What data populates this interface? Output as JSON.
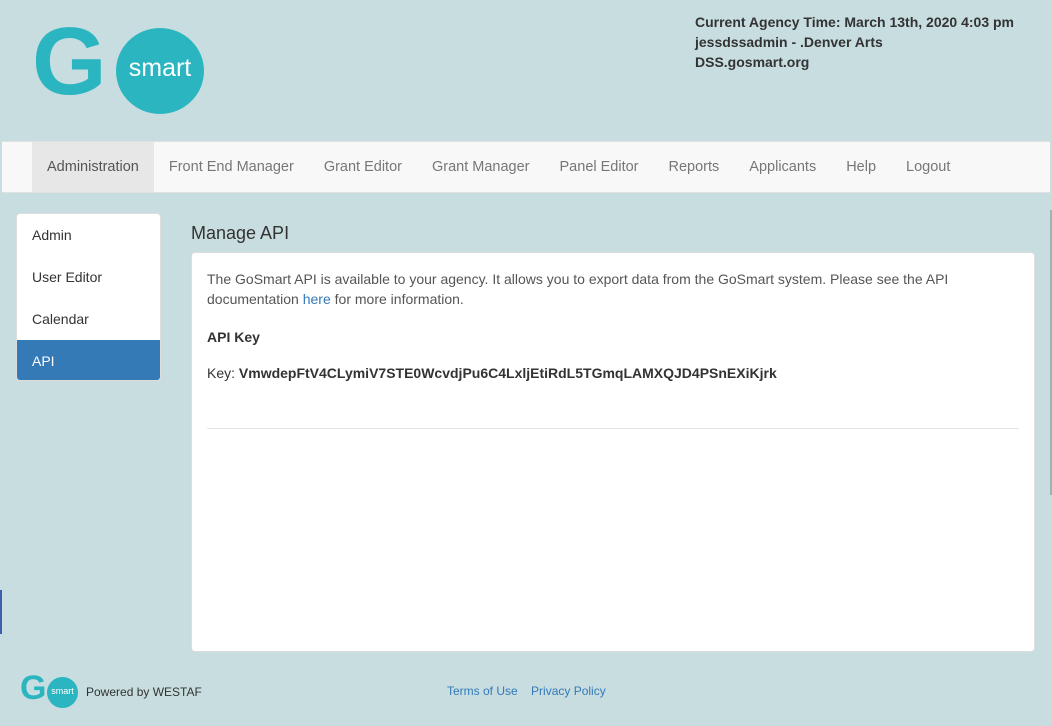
{
  "header": {
    "logo_text": "smart",
    "logo_letter": "G",
    "agency_time": "Current Agency Time: March 13th, 2020 4:03 pm",
    "user_line": "jessdssadmin - .Denver Arts",
    "site": "DSS.gosmart.org"
  },
  "nav": {
    "items": [
      {
        "label": "Administration",
        "active": true
      },
      {
        "label": "Front End Manager"
      },
      {
        "label": "Grant Editor"
      },
      {
        "label": "Grant Manager"
      },
      {
        "label": "Panel Editor"
      },
      {
        "label": "Reports"
      },
      {
        "label": "Applicants"
      },
      {
        "label": "Help"
      },
      {
        "label": "Logout"
      }
    ]
  },
  "sidebar": {
    "items": [
      {
        "label": "Admin"
      },
      {
        "label": "User Editor"
      },
      {
        "label": "Calendar"
      },
      {
        "label": "API",
        "active": true
      }
    ]
  },
  "main": {
    "title": "Manage API",
    "intro_before": "The GoSmart API is available to your agency. It allows you to export data from the GoSmart system. Please see the API documentation ",
    "intro_link": "here",
    "intro_after": " for more information.",
    "api_key_heading": "API Key",
    "key_prefix": "Key: ",
    "key_value": "VmwdepFtV4CLymiV7STE0WcvdjPu6C4LxljEtiRdL5TGmqLAMXQJD4PSnEXiKjrk"
  },
  "footer": {
    "logo_letter": "G",
    "logo_text": "smart",
    "powered_by": "Powered by WESTAF",
    "terms": "Terms of Use",
    "privacy": "Privacy Policy"
  },
  "colors": {
    "background": "#c7dde0",
    "brand": "#2bb5c0",
    "active_blue": "#337ab7"
  }
}
